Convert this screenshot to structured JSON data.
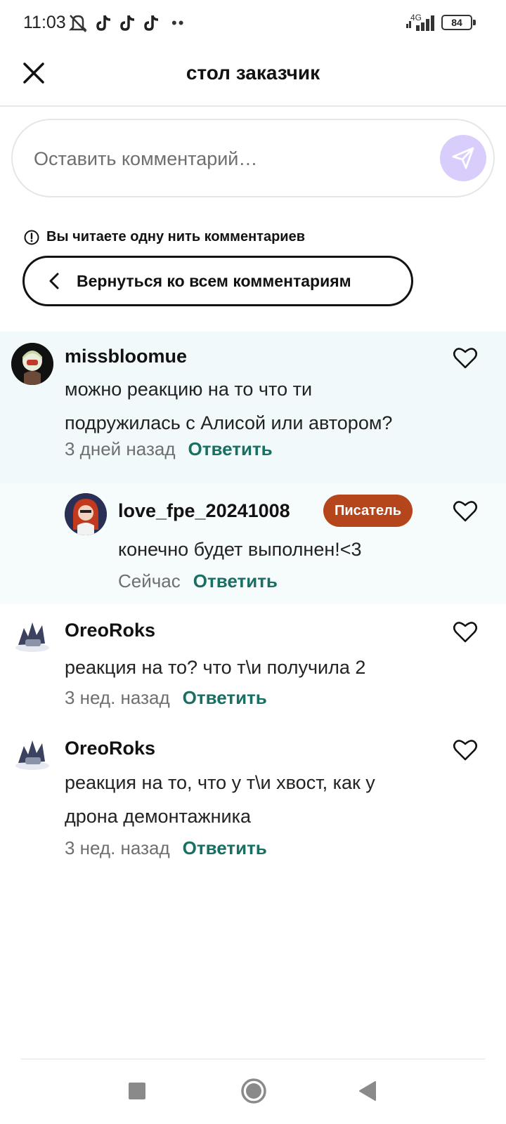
{
  "status_bar": {
    "time": "11:03",
    "network": "4G",
    "battery": "84"
  },
  "header": {
    "title": "стол заказчик"
  },
  "comment_input": {
    "placeholder": "Оставить комментарий…"
  },
  "thread_notice": {
    "text": "Вы читаете одну нить комментариев",
    "back_label": "Вернуться ко всем комментариям"
  },
  "colors": {
    "accent_reply": "#1a6f63",
    "badge": "#b5461b",
    "send_button": "#d9cdfc",
    "highlight": "#f1f9fb"
  },
  "comments": [
    {
      "username": "missbloomue",
      "text_line1": "можно реакцию на то что ти",
      "text_line2": "подружилась с Алисой или автором?",
      "time": "3 дней назад",
      "reply_label": "Ответить"
    },
    {
      "username": "love_fpe_20241008",
      "badge": "Писатель",
      "text_line1": "конечно будет выполнен!<3",
      "time": "Сейчас",
      "reply_label": "Ответить"
    },
    {
      "username": "OreoRoks",
      "text_line1": "реакция на то? что т\\и получила 2",
      "time": "3 нед. назад",
      "reply_label": "Ответить"
    },
    {
      "username": "OreoRoks",
      "text_line1": "реакция на то, что у т\\и хвост, как у",
      "text_line2": "дрона демонтажника",
      "time": "3 нед. назад",
      "reply_label": "Ответить"
    }
  ],
  "icons": [
    "close-icon",
    "send-icon",
    "info-icon",
    "chevron-left-icon",
    "heart-icon",
    "tiktok-icon",
    "mute-icon",
    "square-icon",
    "circle-home-icon",
    "back-triangle-icon"
  ]
}
